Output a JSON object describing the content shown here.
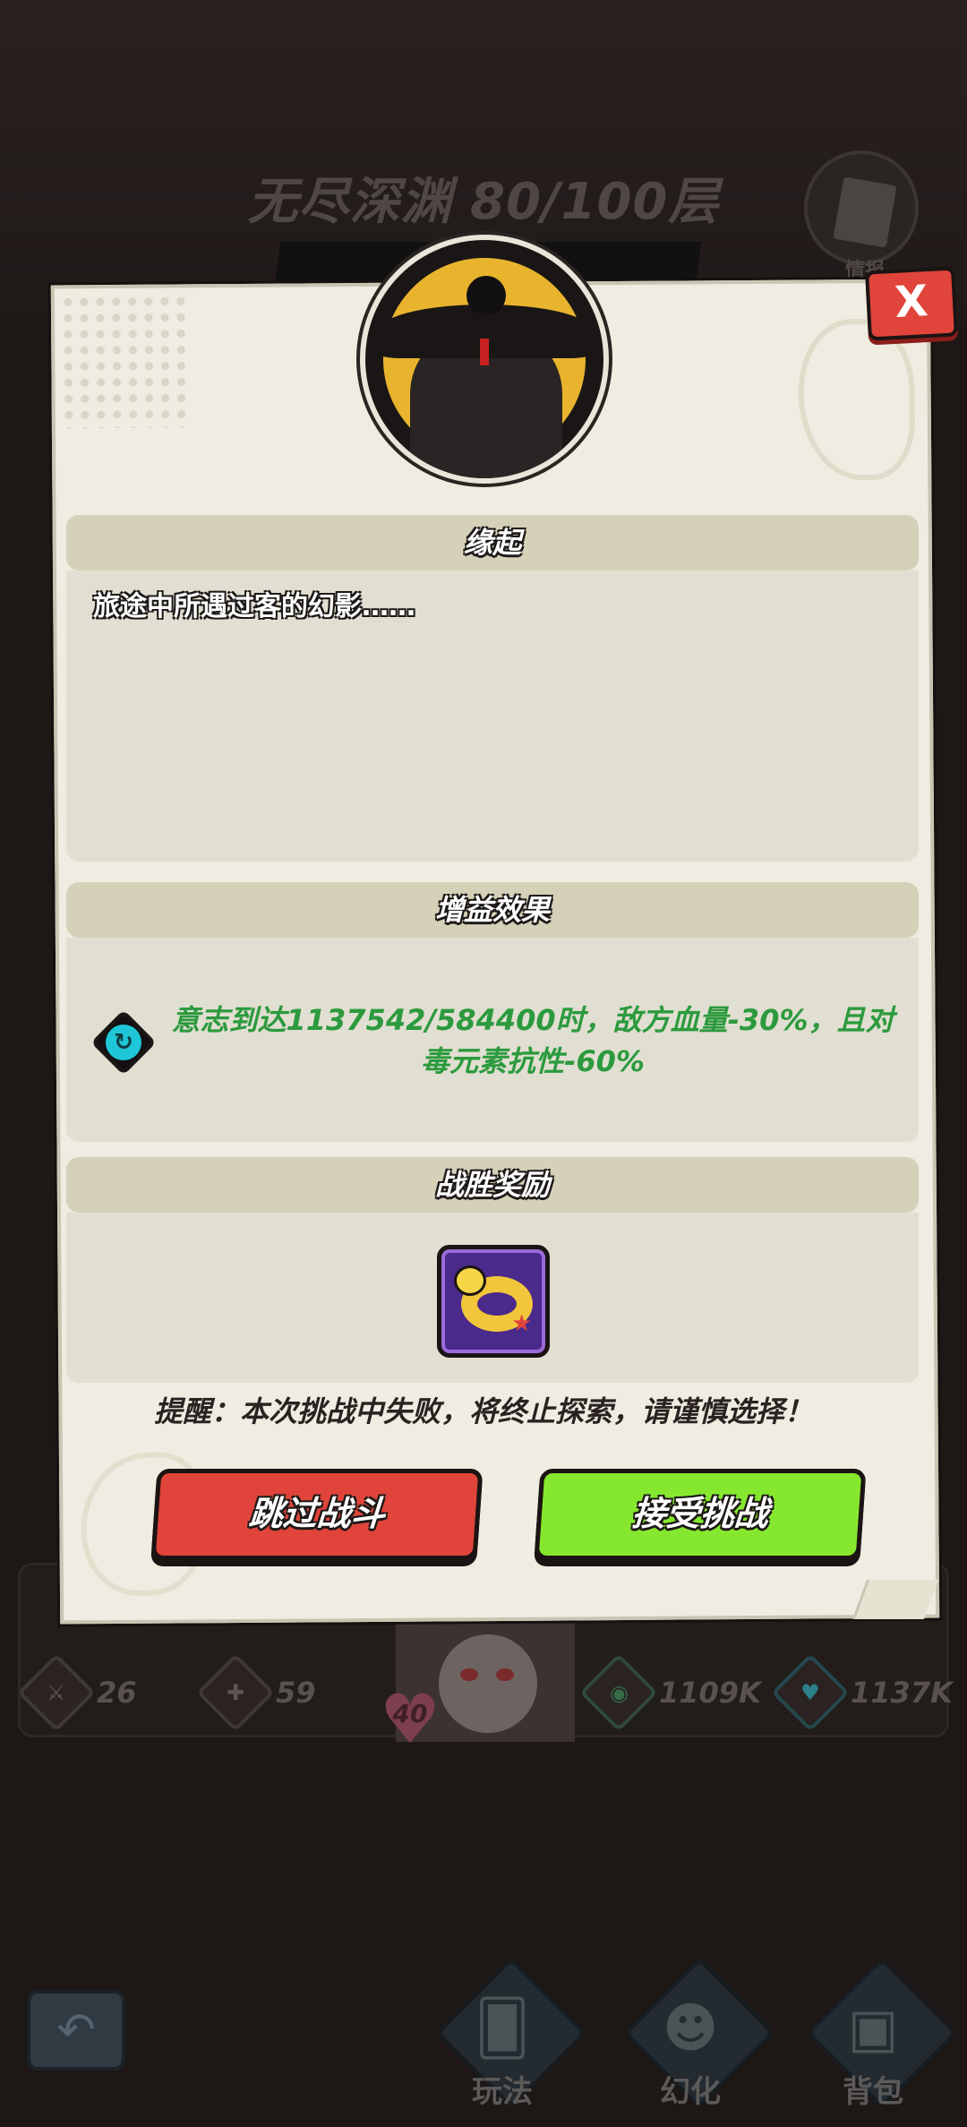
{
  "background": {
    "title": "无尽深渊 80/100层",
    "journal_label": "情报",
    "stats": [
      {
        "icon": "attack-icon",
        "value": "26"
      },
      {
        "icon": "attack-plus-icon",
        "value": "59"
      },
      {
        "icon": "eye-icon",
        "value": "1109K"
      },
      {
        "icon": "will-icon",
        "value": "1137K"
      }
    ],
    "heart_value": "40",
    "nav": [
      {
        "label": "玩法",
        "icon": "cards-icon"
      },
      {
        "label": "幻化",
        "icon": "transform-icon"
      },
      {
        "label": "背包",
        "icon": "backpack-icon"
      }
    ]
  },
  "dialog": {
    "close_label": "X",
    "sections": {
      "origin": {
        "title": "缘起",
        "text": "旅途中所遇过客的幻影……"
      },
      "buff": {
        "title": "增益效果",
        "line1": "意志到达1137542/584400时，敌方血量-30%，且对",
        "line2": "毒元素抗性-60%"
      },
      "reward": {
        "title": "战胜奖励",
        "item_icon": "duck-ring-icon"
      }
    },
    "warning": "提醒：本次挑战中失败，将终止探索，请谨慎选择！",
    "buttons": {
      "skip": "跳过战斗",
      "accept": "接受挑战"
    }
  },
  "colors": {
    "accent_red": "#e0443a",
    "accent_green": "#86e82e",
    "buff_text": "#2c9a3e",
    "dialog_bg": "#efede2"
  }
}
